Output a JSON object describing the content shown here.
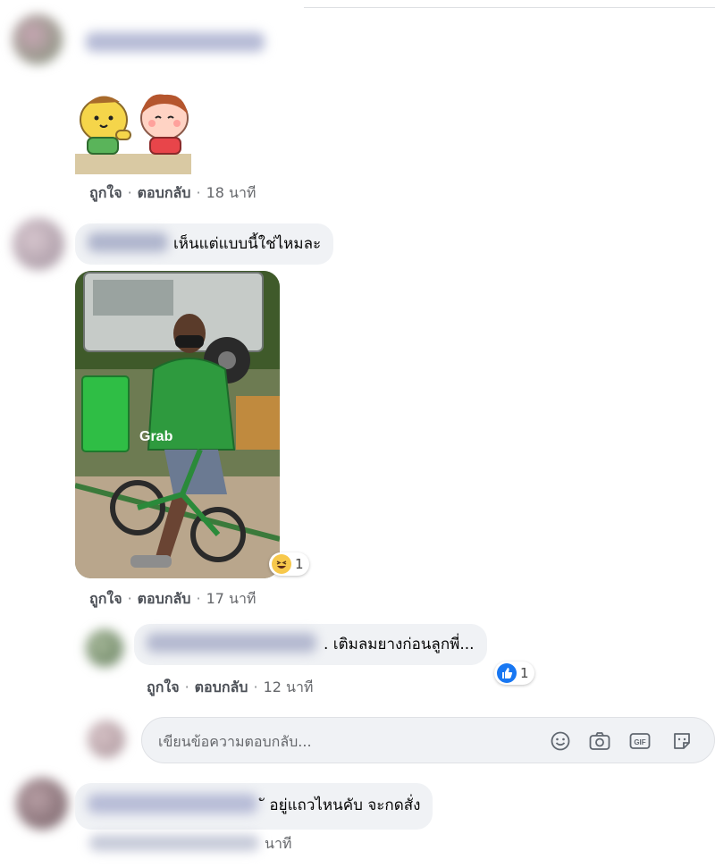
{
  "comments": [
    {
      "id": "c1",
      "actions": {
        "like": "ถูกใจ",
        "reply": "ตอบกลับ",
        "time": "18 นาที"
      }
    },
    {
      "id": "c2",
      "text": "เห็นแต่แบบนี้ใช่ไหมละ",
      "photo_label": "Grab",
      "reaction": {
        "emoji": "haha-icon",
        "count": "1"
      },
      "actions": {
        "like": "ถูกใจ",
        "reply": "ตอบกลับ",
        "time": "17 นาที"
      },
      "replies": [
        {
          "text": ". เติมลมยางก่อนลูกพี่...",
          "reaction": {
            "emoji": "like-icon",
            "count": "1"
          },
          "actions": {
            "like": "ถูกใจ",
            "reply": "ตอบกลับ",
            "time": "12 นาที"
          }
        }
      ],
      "reply_box": {
        "placeholder": "เขียนข้อความตอบกลับ..."
      }
    },
    {
      "id": "c3",
      "text": "ั อยู่แถวไหนคับ จะกดสั่ง",
      "time": "นาที"
    }
  ],
  "colors": {
    "like_blue": "#1877f2",
    "bubble_bg": "#f0f2f5",
    "grab_green": "#00b14f"
  }
}
